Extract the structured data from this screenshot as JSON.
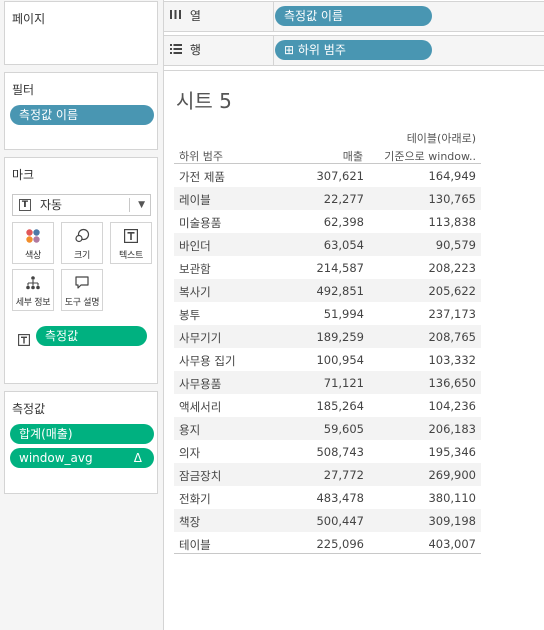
{
  "panels": {
    "pages": {
      "title": "페이지"
    },
    "filters": {
      "title": "필터",
      "pill": "측정값 이름"
    },
    "marks": {
      "title": "마크",
      "type_label": "자동",
      "buttons": {
        "color": "색상",
        "size": "크기",
        "text": "텍스트",
        "detail": "세부 정보",
        "tooltip": "도구 설명"
      },
      "text_pill": "측정값"
    },
    "measures": {
      "title": "측정값",
      "items": [
        {
          "label": "합계(매출)"
        },
        {
          "label": "window_avg",
          "badge": "Δ"
        }
      ]
    }
  },
  "shelves": {
    "columns": {
      "label": "열",
      "pill": "측정값 이름"
    },
    "rows": {
      "label": "행",
      "pill": "하위 범주",
      "pill_prefix": "⊞"
    }
  },
  "sheet": {
    "title": "시트 5",
    "headers": {
      "col1": "하위 범주",
      "col2": "매출",
      "col3_line1": "테이블(아래로)",
      "col3_line2": "기준으로 window.."
    },
    "rows": [
      {
        "name": "가전 제품",
        "sales": "307,621",
        "window": "164,949"
      },
      {
        "name": "레이블",
        "sales": "22,277",
        "window": "130,765"
      },
      {
        "name": "미술용품",
        "sales": "62,398",
        "window": "113,838"
      },
      {
        "name": "바인더",
        "sales": "63,054",
        "window": "90,579"
      },
      {
        "name": "보관함",
        "sales": "214,587",
        "window": "208,223"
      },
      {
        "name": "복사기",
        "sales": "492,851",
        "window": "205,622"
      },
      {
        "name": "봉투",
        "sales": "51,994",
        "window": "237,173"
      },
      {
        "name": "사무기기",
        "sales": "189,259",
        "window": "208,765"
      },
      {
        "name": "사무용 집기",
        "sales": "100,954",
        "window": "103,332"
      },
      {
        "name": "사무용품",
        "sales": "71,121",
        "window": "136,650"
      },
      {
        "name": "액세서리",
        "sales": "185,264",
        "window": "104,236"
      },
      {
        "name": "용지",
        "sales": "59,605",
        "window": "206,183"
      },
      {
        "name": "의자",
        "sales": "508,743",
        "window": "195,346"
      },
      {
        "name": "잠금장치",
        "sales": "27,772",
        "window": "269,900"
      },
      {
        "name": "전화기",
        "sales": "483,478",
        "window": "380,110"
      },
      {
        "name": "책장",
        "sales": "500,447",
        "window": "309,198"
      },
      {
        "name": "테이블",
        "sales": "225,096",
        "window": "403,007"
      }
    ]
  },
  "colors": {
    "pill_blue": "#4996b2",
    "pill_green": "#00b180"
  }
}
